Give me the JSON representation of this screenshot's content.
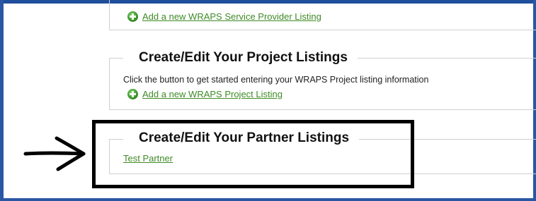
{
  "service_section": {
    "add_link": "Add a new WRAPS Service Provider Listing"
  },
  "project_section": {
    "title": "Create/Edit Your Project Listings",
    "description": "Click the button to get started entering your WRAPS Project listing information",
    "add_link": "Add a new WRAPS Project Listing"
  },
  "partner_section": {
    "title": "Create/Edit Your Partner Listings",
    "items": [
      "Test Partner"
    ]
  },
  "icons": {
    "add": "plus-circle-icon",
    "annotation_arrow": "arrow-right-icon"
  },
  "colors": {
    "link": "#3f8a26",
    "window_edge": "#2a57a3",
    "highlight_box": "#000000"
  }
}
